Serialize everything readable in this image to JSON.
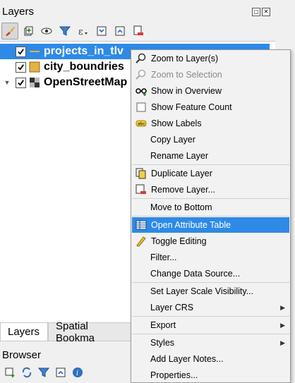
{
  "panel": {
    "title": "Layers"
  },
  "layers": [
    {
      "name": "projects_in_tlv",
      "checked": true,
      "selected": true,
      "type": "line"
    },
    {
      "name": "city_boundries",
      "checked": true,
      "selected": false,
      "type": "polygon"
    },
    {
      "name": "OpenStreetMap",
      "checked": true,
      "selected": false,
      "type": "raster"
    }
  ],
  "tabs": {
    "layers": "Layers",
    "bookmarks": "Spatial Bookma"
  },
  "browser": {
    "title": "Browser"
  },
  "menu": {
    "zoom_to_layer": "Zoom to Layer(s)",
    "zoom_to_selection": "Zoom to Selection",
    "show_in_overview": "Show in Overview",
    "show_feature_count": "Show Feature Count",
    "show_labels": "Show Labels",
    "copy_layer": "Copy Layer",
    "rename_layer": "Rename Layer",
    "duplicate_layer": "Duplicate Layer",
    "remove_layer": "Remove Layer...",
    "move_to_bottom": "Move to Bottom",
    "open_attribute_table": "Open Attribute Table",
    "toggle_editing": "Toggle Editing",
    "filter": "Filter...",
    "change_data_source": "Change Data Source...",
    "set_scale_visibility": "Set Layer Scale Visibility...",
    "layer_crs": "Layer CRS",
    "export": "Export",
    "styles": "Styles",
    "add_layer_notes": "Add Layer Notes...",
    "properties": "Properties..."
  },
  "colors": {
    "selection": "#2e8ae6",
    "polygon_fill": "#e3b341"
  }
}
